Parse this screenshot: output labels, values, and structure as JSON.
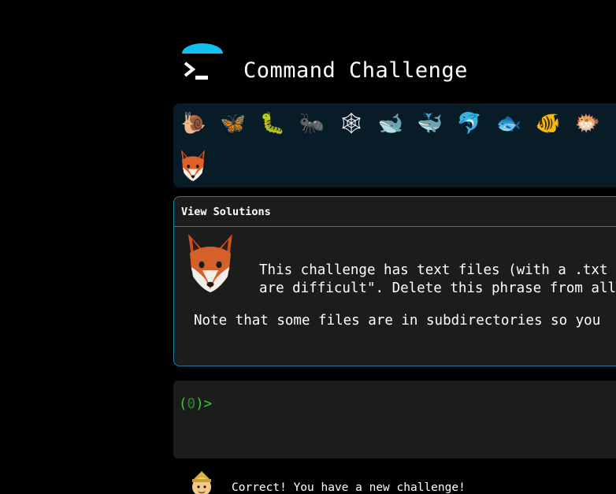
{
  "header": {
    "title": "Command Challenge",
    "logo_icon": "terminal-prompt-icon",
    "accent_color": "#10c0f0"
  },
  "emoji_bar": {
    "background": "#071c27",
    "items": [
      {
        "name": "snail-icon",
        "glyph": "🐌"
      },
      {
        "name": "butterfly-icon",
        "glyph": "🦋"
      },
      {
        "name": "caterpillar-icon",
        "glyph": "🐛"
      },
      {
        "name": "ant-icon",
        "glyph": "🐜"
      },
      {
        "name": "spider-web-icon",
        "glyph": "🕸"
      },
      {
        "name": "whale-icon",
        "glyph": "🐋"
      },
      {
        "name": "spouting-whale-icon",
        "glyph": "🐳"
      },
      {
        "name": "dolphin-icon",
        "glyph": "🐬"
      },
      {
        "name": "fish-icon",
        "glyph": "🐟"
      },
      {
        "name": "tropical-fish-icon",
        "glyph": "🐠"
      },
      {
        "name": "blowfish-icon",
        "glyph": "🐡"
      }
    ],
    "current": "fox-icon"
  },
  "challenge": {
    "view_solutions_label": "View Solutions",
    "description_line1": "This challenge has text files (with a .txt",
    "description_line2": "are difficult\". Delete this phrase from all",
    "note": "Note that some files are in subdirectories so you",
    "border_color": "#1e7fa8"
  },
  "terminal": {
    "prompt_open": "(",
    "prompt_count": "0",
    "prompt_close": ")>",
    "prompt_color": "#2fd12f"
  },
  "feedback": {
    "message": "Correct! You have a new challenge!",
    "avatar_icon": "elf-icon"
  }
}
